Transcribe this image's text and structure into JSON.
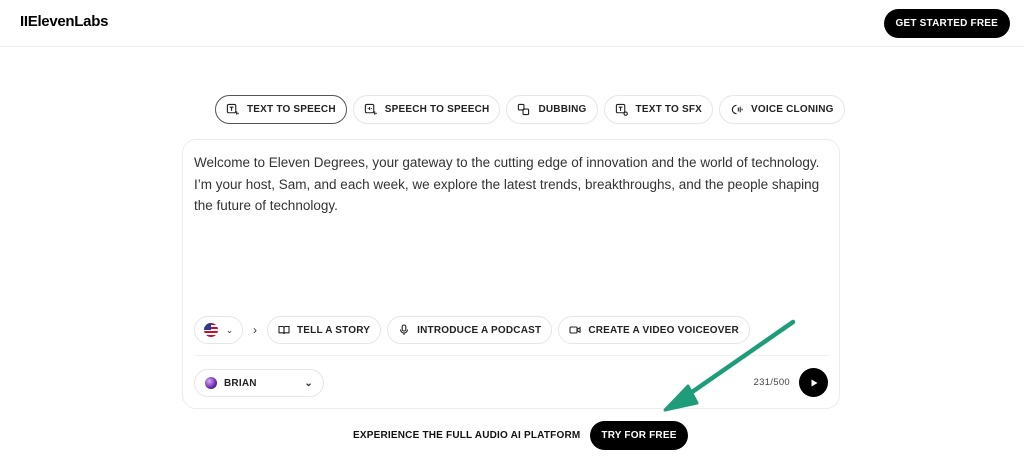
{
  "header": {
    "logo": "IIElevenLabs",
    "cta_label": "GET STARTED FREE"
  },
  "tabs": [
    {
      "label": "TEXT TO SPEECH",
      "icon": "text-to-speech-icon",
      "active": true
    },
    {
      "label": "SPEECH TO SPEECH",
      "icon": "speech-to-speech-icon",
      "active": false
    },
    {
      "label": "DUBBING",
      "icon": "dubbing-icon",
      "active": false
    },
    {
      "label": "TEXT TO SFX",
      "icon": "sfx-icon",
      "active": false
    },
    {
      "label": "VOICE CLONING",
      "icon": "voice-cloning-icon",
      "active": false
    }
  ],
  "editor": {
    "text": "Welcome to Eleven Degrees, your gateway to the cutting edge of innovation and the world of technology. I’m your host, Sam, and each week, we explore the latest trends, breakthroughs, and the people shaping the future of technology."
  },
  "language": {
    "flag": "us-flag-icon"
  },
  "suggestions": [
    {
      "label": "TELL A STORY",
      "icon": "book-icon"
    },
    {
      "label": "INTRODUCE A PODCAST",
      "icon": "microphone-icon"
    },
    {
      "label": "CREATE A VIDEO VOICEOVER",
      "icon": "video-camera-icon"
    }
  ],
  "voice": {
    "name": "BRIAN"
  },
  "counter": "231/500",
  "footer_cta": {
    "text": "EXPERIENCE THE FULL AUDIO AI PLATFORM",
    "button_label": "TRY FOR FREE"
  },
  "colors": {
    "primary": "#000000",
    "annotation_arrow": "#1f9d7a"
  }
}
